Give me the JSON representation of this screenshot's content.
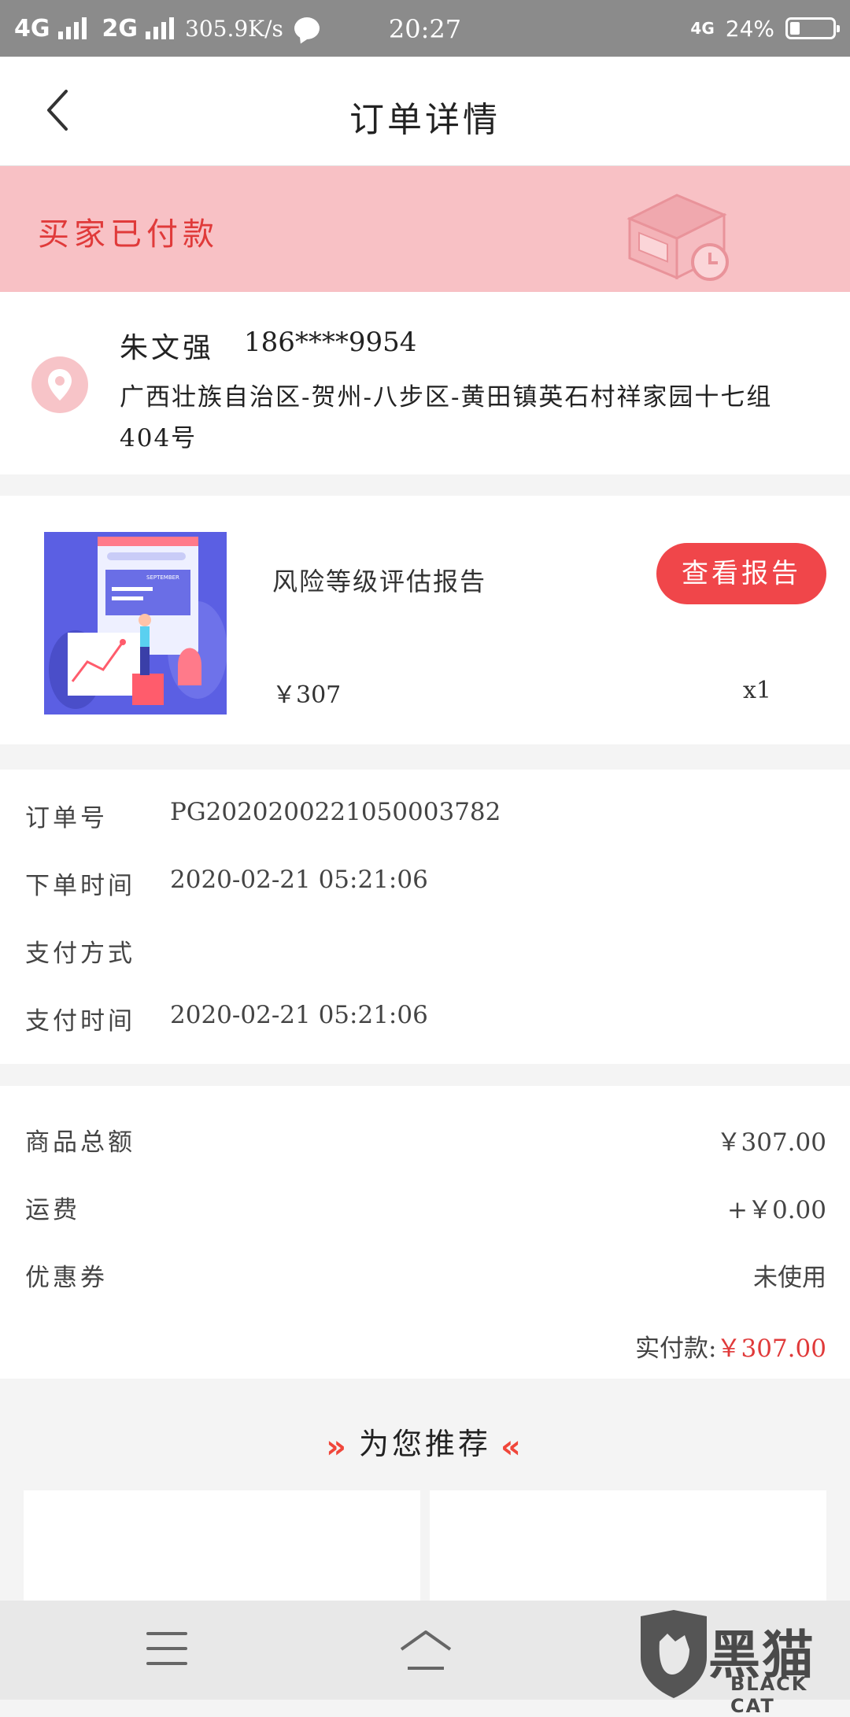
{
  "status_bar": {
    "net1": "4G",
    "net2": "2G",
    "speed": "305.9K/s",
    "time": "20:27",
    "net_type": "4G",
    "battery": "24%",
    "battery_level": 0.24
  },
  "nav": {
    "title": "订单详情",
    "back_icon": "back-arrow-icon"
  },
  "status_banner": {
    "text": "买家已付款",
    "icon": "package-clock-icon"
  },
  "address": {
    "name": "朱文强",
    "phone": "186****9954",
    "detail": "广西壮族自治区-贺州-八步区-黄田镇英石村祥家园十七组404号",
    "icon": "location-pin-icon"
  },
  "product": {
    "name": "风险等级评估报告",
    "action_label": "查看报告",
    "price": "￥307",
    "quantity": "x1",
    "thumb_text": "SEPTEMBER"
  },
  "order_info": [
    {
      "label": "订单号",
      "value": "PG2020200221050003782"
    },
    {
      "label": "下单时间",
      "value": "2020-02-21 05:21:06"
    },
    {
      "label": "支付方式",
      "value": ""
    },
    {
      "label": "支付时间",
      "value": "2020-02-21 05:21:06"
    }
  ],
  "totals": {
    "rows": [
      {
        "label": "商品总额",
        "value": "￥307.00"
      },
      {
        "label": "运费",
        "value": "+￥0.00"
      },
      {
        "label": "优惠券",
        "value": "未使用"
      }
    ],
    "paid_label": "实付款:",
    "paid_value": "￥307.00"
  },
  "recommend": {
    "title": "为您推荐",
    "left_icon": "»",
    "right_icon": "«"
  },
  "bottom_nav": {
    "menu_icon": "menu-icon",
    "home_icon": "home-icon"
  },
  "watermark": {
    "cn": "黑猫",
    "en": "BLACK CAT"
  },
  "colors": {
    "accent": "#f0464a",
    "banner_bg": "#f8c1c5",
    "banner_text": "#e03a3a"
  }
}
